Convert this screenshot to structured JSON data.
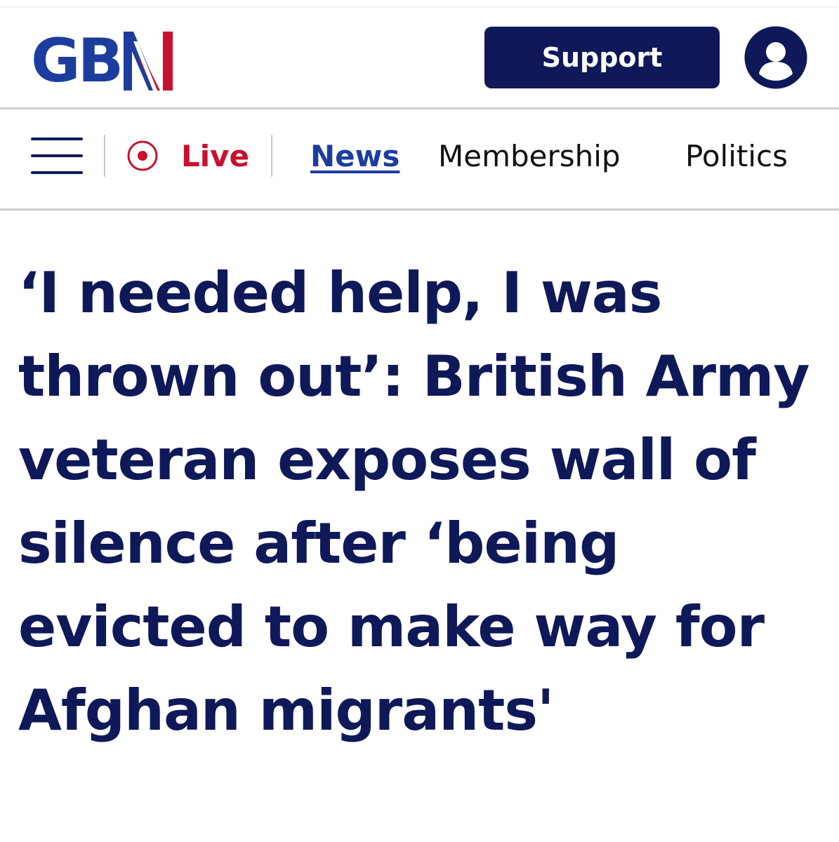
{
  "header": {
    "logo_text": "GB",
    "logo_n": "N",
    "support_label": "Support",
    "colors": {
      "navy": "#0f1858",
      "logo_blue": "#1c3d9e",
      "red": "#c8102e"
    }
  },
  "nav": {
    "live_label": "Live",
    "items": [
      {
        "label": "News",
        "active": true
      },
      {
        "label": "Membership",
        "active": false
      },
      {
        "label": "Politics",
        "active": false
      }
    ]
  },
  "article": {
    "headline": "‘I needed help, I was thrown out’: British Army veteran exposes wall of silence after ‘being evicted to make way for Afghan migrants'"
  },
  "icons": [
    "menu-icon",
    "live-icon",
    "user-icon"
  ]
}
